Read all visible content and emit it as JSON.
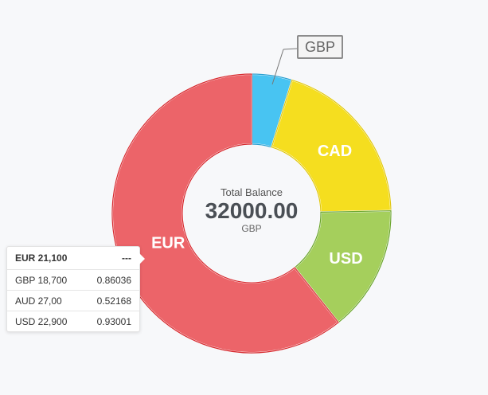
{
  "chart_data": {
    "type": "pie",
    "variant": "donut",
    "categories": [
      "GBP",
      "CAD",
      "USD",
      "EUR"
    ],
    "values": [
      4.7,
      20.0,
      14.6,
      60.7
    ],
    "colors": [
      "#48c4f2",
      "#f5de1f",
      "#a5cf5c",
      "#ec6469"
    ],
    "stroke_colors": [
      "#2a9fd0",
      "#e0c70f",
      "#6aa52c",
      "#d62a2f"
    ],
    "slice_labels": [
      "",
      "CAD",
      "USD",
      "EUR"
    ],
    "callout_label": "GBP",
    "center": {
      "title": "Total Balance",
      "value": "32000.00",
      "unit": "GBP"
    }
  },
  "tooltip": {
    "header": {
      "label": "EUR 21,100",
      "value": "---"
    },
    "rows": [
      {
        "label": "GBP 18,700",
        "value": "0.86036"
      },
      {
        "label": "AUD 27,00",
        "value": "0.52168"
      },
      {
        "label": "USD 22,900",
        "value": "0.93001"
      }
    ]
  }
}
